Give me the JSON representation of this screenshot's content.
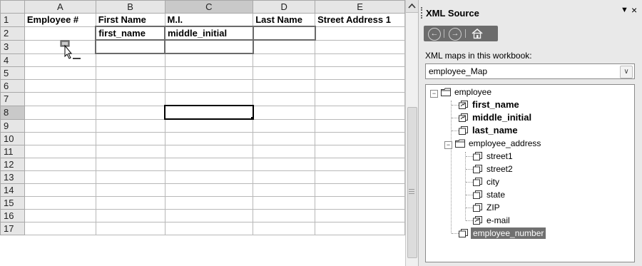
{
  "sheet": {
    "columns": [
      "A",
      "B",
      "C",
      "D",
      "E"
    ],
    "selected_column": "C",
    "selected_row": "8",
    "rows": [
      "1",
      "2",
      "3",
      "4",
      "5",
      "6",
      "7",
      "8",
      "9",
      "10",
      "11",
      "12",
      "13",
      "14",
      "15",
      "16",
      "17"
    ],
    "row1": {
      "A": "Employee #",
      "B": "First Name",
      "C": "M.I.",
      "D": "Last Name",
      "E": "Street Address 1"
    },
    "row2": {
      "A": "",
      "B": "first_name",
      "C": "middle_initial",
      "D": "",
      "E": ""
    }
  },
  "pane": {
    "title": "XML Source",
    "menu_icon": "dropdown-arrow-icon",
    "close_icon": "close-icon",
    "nav": {
      "back": "←",
      "forward": "→"
    },
    "maps_label": "XML maps in this workbook:",
    "map_selected": "employee_Map",
    "tree": {
      "root": "employee",
      "first_name": "first_name",
      "middle_initial": "middle_initial",
      "last_name": "last_name",
      "address_group": "employee_address",
      "street1": "street1",
      "street2": "street2",
      "city": "city",
      "state": "state",
      "zip": "ZIP",
      "email": "e-mail",
      "employee_number": "employee_number"
    }
  }
}
